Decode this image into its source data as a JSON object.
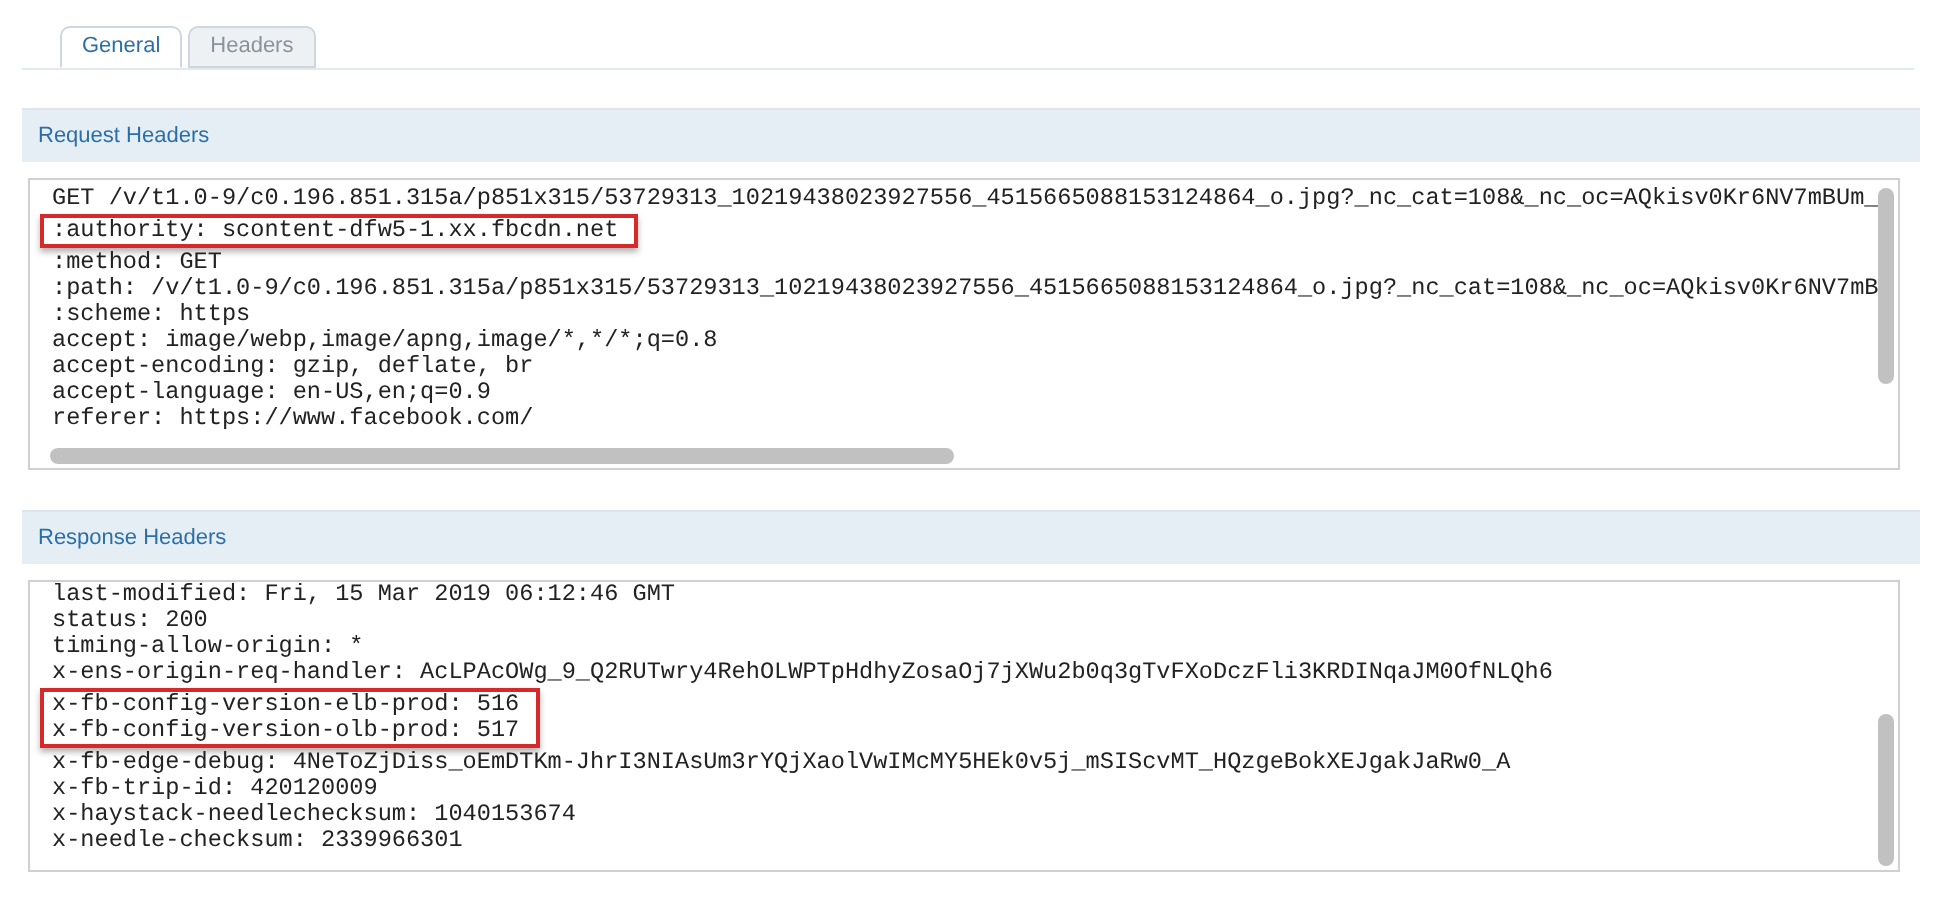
{
  "tabs": [
    {
      "label": "General",
      "selected": true
    },
    {
      "label": "Headers",
      "selected": false
    }
  ],
  "sections": [
    {
      "title": "Request Headers",
      "horizontal_scroll": true,
      "lines": [
        {
          "text": "GET /v/t1.0-9/c0.196.851.315a/p851x315/53729313_10219438023927556_4515665088153124864_o.jpg?_nc_cat=108&_nc_oc=AQkisv0Kr6NV7mBUm_",
          "highlighted": false
        },
        {
          "text": ":authority: scontent-dfw5-1.xx.fbcdn.net",
          "highlighted": true
        },
        {
          "text": ":method: GET",
          "highlighted": false
        },
        {
          "text": ":path: /v/t1.0-9/c0.196.851.315a/p851x315/53729313_10219438023927556_4515665088153124864_o.jpg?_nc_cat=108&_nc_oc=AQkisv0Kr6NV7mB",
          "highlighted": false
        },
        {
          "text": ":scheme: https",
          "highlighted": false
        },
        {
          "text": "accept: image/webp,image/apng,image/*,*/*;q=0.8",
          "highlighted": false
        },
        {
          "text": "accept-encoding: gzip, deflate, br",
          "highlighted": false
        },
        {
          "text": "accept-language: en-US,en;q=0.9",
          "highlighted": false
        },
        {
          "text": "referer: https://www.facebook.com/",
          "highlighted": false
        }
      ]
    },
    {
      "title": "Response Headers",
      "horizontal_scroll": false,
      "lines": [
        {
          "text": "last-modified: Fri, 15 Mar 2019 06:12:46 GMT",
          "highlighted": false
        },
        {
          "text": "status: 200",
          "highlighted": false
        },
        {
          "text": "timing-allow-origin: *",
          "highlighted": false
        },
        {
          "text": "x-ens-origin-req-handler: AcLPAcOWg_9_Q2RUTwry4RehOLWPTpHdhyZosaOj7jXWu2b0q3gTvFXoDczFli3KRDINqaJM0OfNLQh6",
          "highlighted": false
        },
        {
          "text": "x-fb-config-version-elb-prod: 516",
          "highlighted": true
        },
        {
          "text": "x-fb-config-version-olb-prod: 517",
          "highlighted": true
        },
        {
          "text": "x-fb-edge-debug: 4NeToZjDiss_oEmDTKm-JhrI3NIAsUm3rYQjXaolVwIMcMY5HEk0v5j_mSIScvMT_HQzgeBokXEJgakJaRw0_A",
          "highlighted": false
        },
        {
          "text": "x-fb-trip-id: 420120009",
          "highlighted": false
        },
        {
          "text": "x-haystack-needlechecksum: 1040153674",
          "highlighted": false
        },
        {
          "text": "x-needle-checksum: 2339966301",
          "highlighted": false
        }
      ]
    }
  ]
}
